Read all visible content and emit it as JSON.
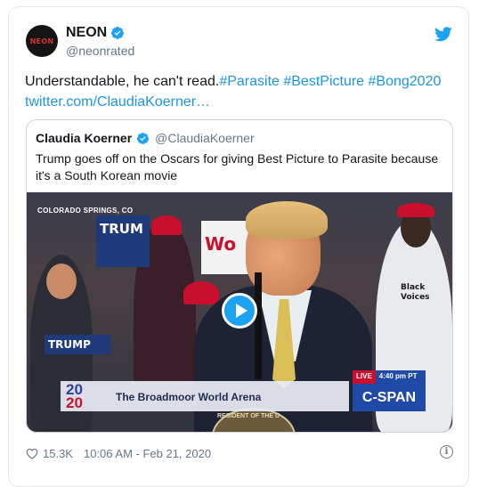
{
  "account": {
    "display_name": "NEON",
    "handle": "@neonrated",
    "avatar_text": "NEON",
    "verified": true
  },
  "tweet": {
    "text_plain": "Understandable, he can't read.",
    "hashtags": "#Parasite #BestPicture #Bong2020",
    "link": "twitter.com/ClaudiaKoerner…"
  },
  "quoted_tweet": {
    "display_name": "Claudia Koerner",
    "handle": "@ClaudiaKoerner",
    "verified": true,
    "text": "Trump goes off on the Oscars for giving Best Picture to Parasite because it's a South Korean movie",
    "media": {
      "location": "COLORADO SPRINGS, CO",
      "logo_top": "20",
      "logo_bottom": "20",
      "venue": "The Broadmoor World Arena",
      "live_label": "LIVE",
      "time": "4:40 pm PT",
      "network": "C-SPAN",
      "seal_text": "RESIDENT OF THE U",
      "sign_1": "TRUM",
      "sign_2": "TRUMP",
      "sign_3": "Wo",
      "sign_4": "Black Voices"
    }
  },
  "footer": {
    "likes": "15.3K",
    "timestamp": "10:06 AM - Feb 21, 2020",
    "info_glyph": "i"
  },
  "colors": {
    "link": "#1b95e0",
    "twitter_blue": "#1da1f2",
    "secondary_text": "#657786",
    "border": "#e1e8ed"
  }
}
